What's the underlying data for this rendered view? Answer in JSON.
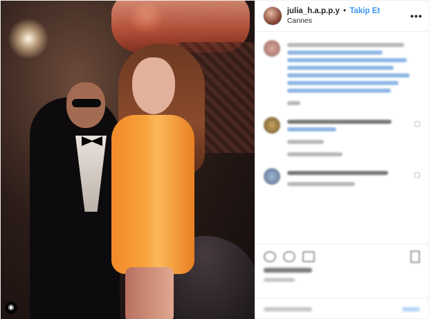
{
  "header": {
    "username": "julia_h.a.p.p.y",
    "separator": "•",
    "follow_label": "Takip Et",
    "location": "Cannes",
    "more_label": "•••"
  },
  "photo": {
    "camera_icon": "camera-icon",
    "camera_glyph": "◉"
  },
  "colors": {
    "accent": "#3897f0",
    "text": "#262626",
    "border": "#efefef"
  }
}
